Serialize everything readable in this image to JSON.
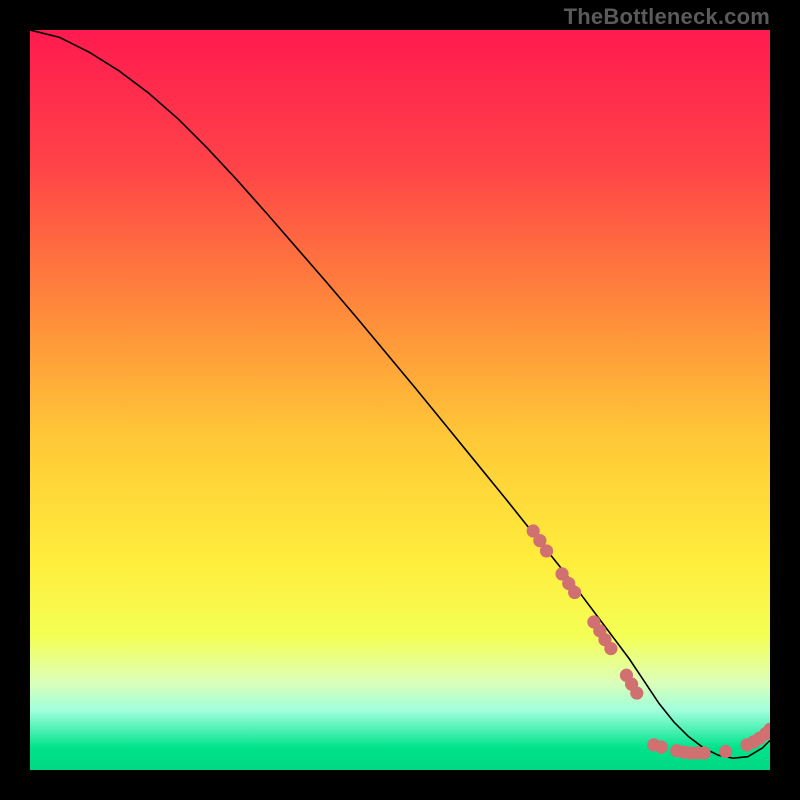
{
  "watermark": "TheBottleneck.com",
  "chart_data": {
    "type": "line",
    "title": "",
    "xlabel": "",
    "ylabel": "",
    "xlim": [
      0,
      100
    ],
    "ylim": [
      0,
      100
    ],
    "background_gradient": {
      "orientation": "vertical",
      "stops": [
        {
          "pos": 0.0,
          "color": "#ff1a4f"
        },
        {
          "pos": 0.18,
          "color": "#ff4248"
        },
        {
          "pos": 0.38,
          "color": "#ff8a3b"
        },
        {
          "pos": 0.55,
          "color": "#ffc837"
        },
        {
          "pos": 0.72,
          "color": "#ffee3c"
        },
        {
          "pos": 0.82,
          "color": "#f4ff56"
        },
        {
          "pos": 0.88,
          "color": "#ddffb7"
        },
        {
          "pos": 0.92,
          "color": "#9fffde"
        },
        {
          "pos": 0.97,
          "color": "#00e38a"
        },
        {
          "pos": 1.0,
          "color": "#00d882"
        }
      ]
    },
    "series": [
      {
        "name": "bottleneck-curve",
        "color": "#000000",
        "x": [
          0,
          4,
          8,
          12,
          16,
          20,
          24,
          28,
          32,
          36,
          40,
          44,
          48,
          52,
          56,
          60,
          64,
          68,
          72,
          75,
          78,
          81,
          83,
          85,
          87,
          89,
          91,
          93,
          95,
          97,
          99,
          100
        ],
        "y": [
          100,
          99,
          97,
          94.5,
          91.5,
          88,
          84,
          79.7,
          75.2,
          70.6,
          66,
          61.3,
          56.5,
          51.7,
          46.8,
          41.9,
          37,
          32,
          27,
          23,
          19,
          15,
          12,
          9,
          6.5,
          4.5,
          3,
          2,
          1.6,
          1.8,
          3,
          4
        ]
      }
    ],
    "highlight_dots": {
      "color": "#d07070",
      "radius": 6.6,
      "points": [
        {
          "x": 68.0,
          "y": 32.3
        },
        {
          "x": 68.9,
          "y": 31.0
        },
        {
          "x": 69.8,
          "y": 29.6
        },
        {
          "x": 71.9,
          "y": 26.5
        },
        {
          "x": 72.8,
          "y": 25.2
        },
        {
          "x": 73.6,
          "y": 24.0
        },
        {
          "x": 76.2,
          "y": 20.0
        },
        {
          "x": 77.0,
          "y": 18.8
        },
        {
          "x": 77.7,
          "y": 17.6
        },
        {
          "x": 78.5,
          "y": 16.4
        },
        {
          "x": 80.6,
          "y": 12.8
        },
        {
          "x": 81.3,
          "y": 11.6
        },
        {
          "x": 82.0,
          "y": 10.4
        },
        {
          "x": 84.3,
          "y": 3.4
        },
        {
          "x": 85.3,
          "y": 3.1
        },
        {
          "x": 87.4,
          "y": 2.6
        },
        {
          "x": 88.4,
          "y": 2.4
        },
        {
          "x": 89.3,
          "y": 2.3
        },
        {
          "x": 90.2,
          "y": 2.3
        },
        {
          "x": 91.1,
          "y": 2.3
        },
        {
          "x": 94.0,
          "y": 2.5
        },
        {
          "x": 96.9,
          "y": 3.4
        },
        {
          "x": 97.8,
          "y": 3.8
        },
        {
          "x": 98.6,
          "y": 4.3
        },
        {
          "x": 99.4,
          "y": 4.9
        },
        {
          "x": 100.0,
          "y": 5.5
        }
      ]
    }
  }
}
